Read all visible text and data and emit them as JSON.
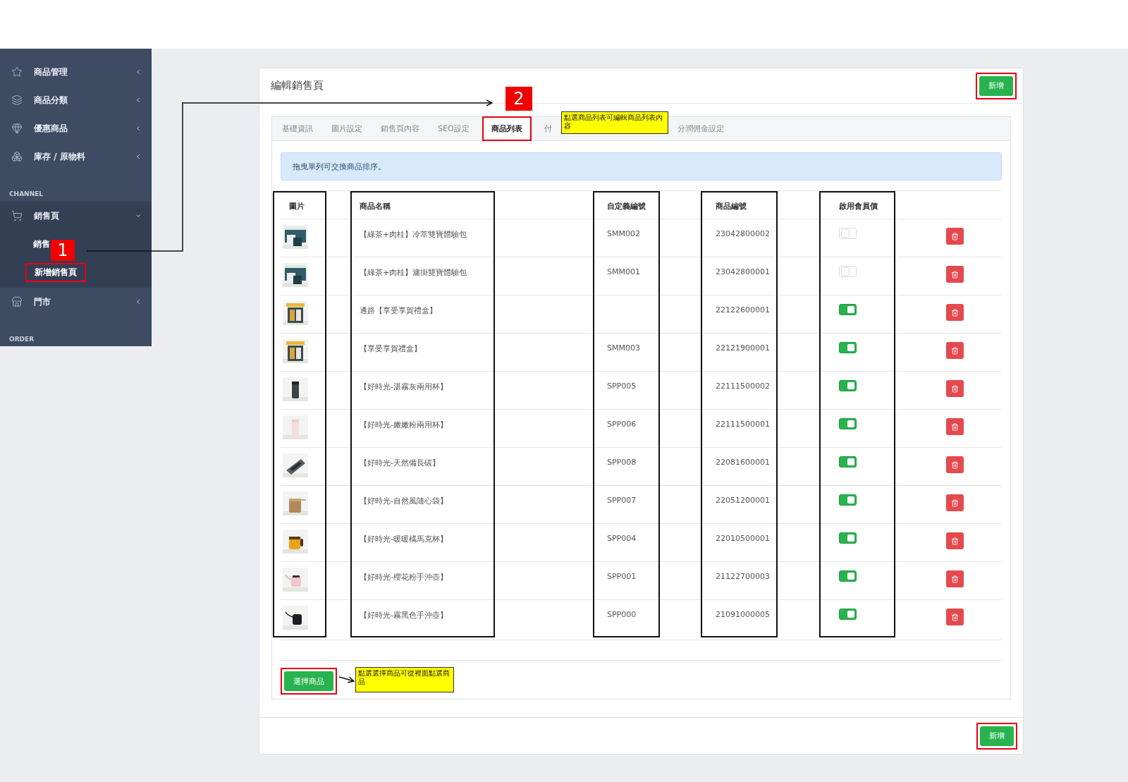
{
  "sidebar": {
    "entries": [
      {
        "kind": "item",
        "label": "商品管理",
        "expanded": false
      },
      {
        "kind": "item",
        "label": "商品分類",
        "expanded": false
      },
      {
        "kind": "item",
        "label": "優惠商品",
        "expanded": false
      },
      {
        "kind": "item",
        "label": "庫存 / 原物料",
        "expanded": false
      },
      {
        "kind": "header",
        "label": "CHANNEL"
      },
      {
        "kind": "item",
        "label": "銷售頁",
        "expanded": true,
        "children": [
          {
            "label": "銷售",
            "highlighted": false
          },
          {
            "label": "新增銷售頁",
            "highlighted": true
          }
        ]
      },
      {
        "kind": "item",
        "label": "門市",
        "expanded": false
      },
      {
        "kind": "header",
        "label": "ORDER"
      }
    ]
  },
  "card": {
    "title": "編輯銷售頁",
    "header_button": {
      "label": "新增",
      "highlighted": true
    },
    "tabs": [
      {
        "label": "基礎資訊",
        "selected": false,
        "highlighted": false
      },
      {
        "label": "圖片設定",
        "selected": false,
        "highlighted": false
      },
      {
        "label": "銷售頁內容",
        "selected": false,
        "highlighted": false
      },
      {
        "label": "SEO設定",
        "selected": false,
        "highlighted": false
      },
      {
        "label": "商品列表",
        "selected": true,
        "highlighted": true
      },
      {
        "label": "付",
        "selected": false,
        "highlighted": false
      },
      {
        "label": "分潤佣金設定",
        "selected": false,
        "highlighted": false
      }
    ],
    "alert": "拖曳單列可交換商品排序。",
    "table": {
      "columns": [
        {
          "label": "圖片",
          "outlined": true
        },
        {
          "label": "商品名稱",
          "outlined": true
        },
        {
          "label": "自定義編號",
          "outlined": true
        },
        {
          "label": "商品編號",
          "outlined": true
        },
        {
          "label": "啟用會員價",
          "outlined": true
        }
      ],
      "rows": [
        {
          "name": "【綠茶+肉桂】冷萃雙寶體驗包",
          "custom_code": "SMM002",
          "product_code": "23042800002",
          "member_price": false
        },
        {
          "name": "【綠茶+肉桂】濾掛雙寶體驗包",
          "custom_code": "SMM001",
          "product_code": "23042800001",
          "member_price": false
        },
        {
          "name": "通路【享受享賀禮盒】",
          "product_code": "22122600001",
          "member_price": true
        },
        {
          "name": "【享受享賀禮盒】",
          "custom_code": "SMM003",
          "product_code": "22121900001",
          "member_price": true
        },
        {
          "name": "【好時光-湛霧灰兩用杯】",
          "custom_code": "SPP005",
          "product_code": "22111500002",
          "member_price": true
        },
        {
          "name": "【好時光-嫩嫩粉兩用杯】",
          "custom_code": "SPP006",
          "product_code": "22111500001",
          "member_price": true
        },
        {
          "name": "【好時光-天然備長碳】",
          "custom_code": "SPP008",
          "product_code": "22081600001",
          "member_price": true
        },
        {
          "name": "【好時光-自然風隨心袋】",
          "custom_code": "SPP007",
          "product_code": "22051200001",
          "member_price": true
        },
        {
          "name": "【好時光-暖暖橘馬克杯】",
          "custom_code": "SPP004",
          "product_code": "22010500001",
          "member_price": true
        },
        {
          "name": "【好時光-櫻花粉手沖壺】",
          "custom_code": "SPP001",
          "product_code": "21122700003",
          "member_price": true
        },
        {
          "name": "【好時光-霧黑色手沖壺】",
          "custom_code": "SPP000",
          "product_code": "21091000005",
          "member_price": true
        }
      ]
    },
    "select_button": {
      "label": "選擇商品",
      "highlighted": true
    },
    "footer_button": {
      "label": "新增",
      "highlighted": true
    }
  },
  "annotations": {
    "badges": [
      {
        "text": "1"
      },
      {
        "text": "2"
      }
    ],
    "notes": [
      {
        "text": "點選商品列表可編輯商品列表內容"
      },
      {
        "text": "點選選擇商品可從裡面點選商品"
      }
    ]
  }
}
